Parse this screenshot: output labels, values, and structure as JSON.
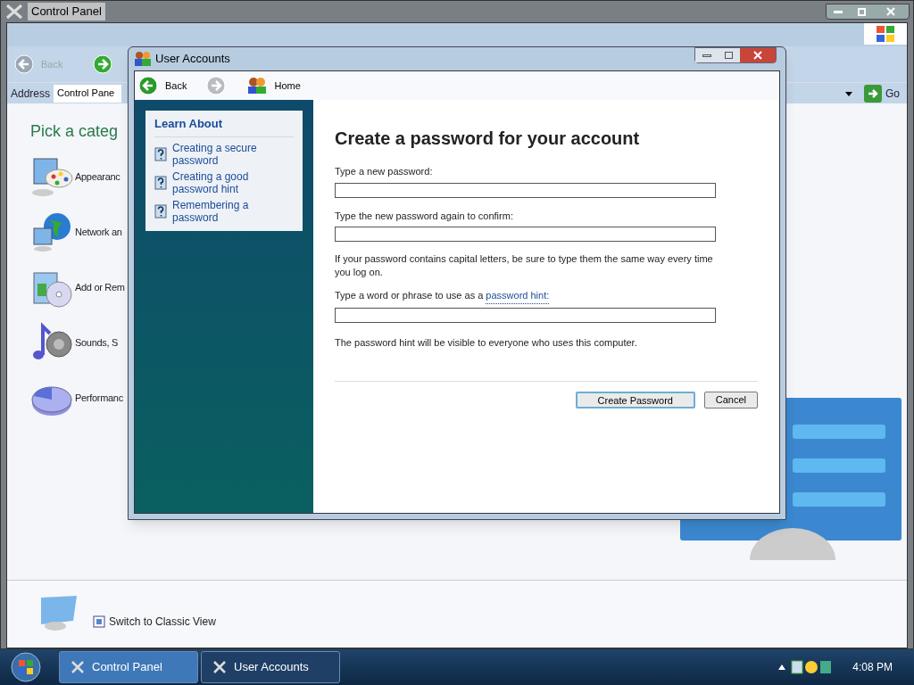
{
  "back_window": {
    "title": "Control Panel",
    "toolbar": {
      "back": "Back"
    },
    "address": {
      "label": "Address",
      "value": "Control Pane",
      "go": "Go"
    },
    "heading": "Pick a categ",
    "categories": [
      {
        "label": "Appearanc",
        "kind": "palette"
      },
      {
        "label": "Network an",
        "kind": "globe"
      },
      {
        "label": "Add or Rem",
        "kind": "disc"
      },
      {
        "label": "Sounds, S",
        "kind": "sound"
      },
      {
        "label": "Performanc",
        "kind": "pie"
      }
    ],
    "bottom_link": "Switch to Classic View"
  },
  "dialog": {
    "title": "User Accounts",
    "nav": {
      "back": "Back",
      "home": "Home"
    },
    "learn_about": {
      "title": "Learn About",
      "links": [
        "Creating a secure password",
        "Creating a good password hint",
        "Remembering a password"
      ]
    },
    "heading": "Create a password for your account",
    "fields": [
      {
        "label": "Type a new password:"
      },
      {
        "label": "Type the new password again to confirm:"
      }
    ],
    "note": "If your password contains capital letters, be sure to type them the same way every time you log on.",
    "hint_label": "Type a word or phrase to use as a",
    "hint_link": "password hint:",
    "hint_note": "The password hint will be visible to everyone who uses this computer.",
    "buttons": [
      {
        "label": "Create Password",
        "kind": "default"
      },
      {
        "label": "Cancel",
        "kind": "normal"
      }
    ]
  },
  "taskbar": {
    "items": [
      {
        "label": "Control Panel",
        "selected": true
      },
      {
        "label": "User Accounts",
        "selected": false
      }
    ],
    "clock": "4:08 PM"
  }
}
